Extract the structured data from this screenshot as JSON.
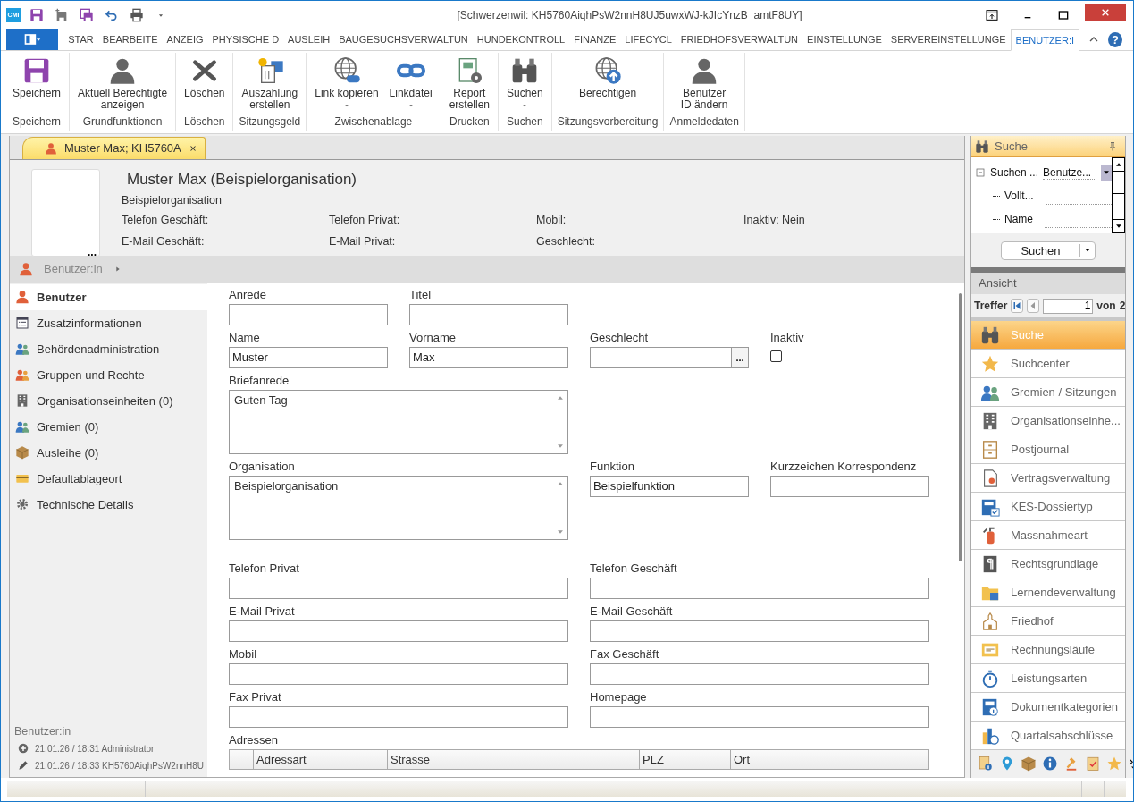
{
  "window": {
    "logo": "CMI",
    "title": "[Schwerzenwil: KH5760AiqhPsW2nnH8UJ5uwxWJ-kJIcYnzB_amtF8UY]",
    "help": "?"
  },
  "ribbon_tabs": [
    {
      "label": "STAR",
      "selected": false
    },
    {
      "label": "BEARBEITE",
      "selected": false
    },
    {
      "label": "ANZEIG",
      "selected": false
    },
    {
      "label": "PHYSISCHE D",
      "selected": false
    },
    {
      "label": "AUSLEIH",
      "selected": false
    },
    {
      "label": "BAUGESUCHSVERWALTUN",
      "selected": false
    },
    {
      "label": "HUNDEKONTROLL",
      "selected": false
    },
    {
      "label": "FINANZE",
      "selected": false
    },
    {
      "label": "LIFECYCL",
      "selected": false
    },
    {
      "label": "FRIEDHOFSVERWALTUN",
      "selected": false
    },
    {
      "label": "EINSTELLUNGE",
      "selected": false
    },
    {
      "label": "SERVEREINSTELLUNGE",
      "selected": false
    },
    {
      "label": "BENUTZER:I",
      "selected": true
    }
  ],
  "ribbon_groups": [
    {
      "label": "Speichern",
      "buttons": [
        {
          "label": "Speichern",
          "dropdown": false
        }
      ]
    },
    {
      "label": "Grundfunktionen",
      "buttons": [
        {
          "label": "Aktuell Berechtigte\nanzeigen",
          "dropdown": false
        }
      ]
    },
    {
      "label": "Löschen",
      "buttons": [
        {
          "label": "Löschen",
          "dropdown": false
        }
      ]
    },
    {
      "label": "Sitzungsgeld",
      "buttons": [
        {
          "label": "Auszahlung\nerstellen",
          "dropdown": false
        }
      ]
    },
    {
      "label": "Zwischenablage",
      "buttons": [
        {
          "label": "Link kopieren",
          "dropdown": true
        },
        {
          "label": "Linkdatei",
          "dropdown": true
        }
      ]
    },
    {
      "label": "Drucken",
      "buttons": [
        {
          "label": "Report\nerstellen",
          "dropdown": false
        }
      ]
    },
    {
      "label": "Suchen",
      "buttons": [
        {
          "label": "Suchen",
          "dropdown": true
        }
      ]
    },
    {
      "label": "Sitzungsvorbereitung",
      "buttons": [
        {
          "label": "Berechtigen",
          "dropdown": false
        }
      ]
    },
    {
      "label": "Anmeldedaten",
      "buttons": [
        {
          "label": "Benutzer\nID ändern",
          "dropdown": false
        }
      ]
    }
  ],
  "document_tab": {
    "label": "Muster Max; KH5760A",
    "selected": true
  },
  "header": {
    "title": "Muster Max (Beispielorganisation)",
    "subtitle": "Beispielorganisation",
    "photo_more": "...",
    "info": [
      "Telefon Geschäft:",
      "Telefon Privat:",
      "Mobil:",
      "Inaktiv: Nein",
      "E-Mail Geschäft:",
      "E-Mail Privat:",
      "Geschlecht:"
    ]
  },
  "breadcrumb": {
    "label": "Benutzer:in"
  },
  "nav": [
    {
      "label": "Benutzer",
      "selected": true
    },
    {
      "label": "Zusatzinformationen",
      "selected": false
    },
    {
      "label": "Behördenadministration",
      "selected": false
    },
    {
      "label": "Gruppen und Rechte",
      "selected": false
    },
    {
      "label": "Organisationseinheiten (0)",
      "selected": false
    },
    {
      "label": "Gremien (0)",
      "selected": false
    },
    {
      "label": "Ausleihe (0)",
      "selected": false
    },
    {
      "label": "Defaultablageort",
      "selected": false
    },
    {
      "label": "Technische Details",
      "selected": false
    }
  ],
  "audit": {
    "title": "Benutzer:in",
    "created": "21.01.26 / 18:31 Administrator",
    "modified": "21.01.26 / 18:33 KH5760AiqhPsW2nnH8U"
  },
  "form": {
    "sections": [
      {
        "rows": [
          [
            {
              "label": "Anrede",
              "kind": "text"
            },
            {
              "label": "Titel",
              "kind": "text"
            }
          ],
          [
            {
              "label": "Name",
              "kind": "text",
              "value": "Muster"
            },
            {
              "label": "Vorname",
              "kind": "text",
              "value": "Max"
            },
            {
              "label": "Geschlecht",
              "kind": "picker",
              "button": "..."
            },
            {
              "label": "Inaktiv",
              "kind": "checkbox",
              "checked": false
            }
          ],
          [
            {
              "label": "Briefanrede",
              "kind": "textarea",
              "value": "Guten Tag"
            }
          ],
          [
            {
              "label": "Organisation",
              "kind": "textarea",
              "value": "Beispielorganisation"
            },
            "",
            {
              "label": "Funktion",
              "kind": "text",
              "value": "Beispielfunktion"
            },
            {
              "label": "Kurzzeichen Korrespondenz",
              "kind": "text"
            }
          ]
        ]
      },
      {
        "rows": [
          [
            {
              "label": "Telefon Privat",
              "kind": "wide"
            },
            "",
            {
              "label": "Telefon Geschäft",
              "kind": "wide"
            }
          ],
          [
            {
              "label": "E-Mail Privat",
              "kind": "wide"
            },
            "",
            {
              "label": "E-Mail Geschäft",
              "kind": "wide"
            }
          ],
          [
            {
              "label": "Mobil",
              "kind": "wide"
            },
            "",
            {
              "label": "Fax Geschäft",
              "kind": "wide"
            }
          ],
          [
            {
              "label": "Fax Privat",
              "kind": "wide"
            },
            "",
            {
              "label": "Homepage",
              "kind": "wide"
            }
          ]
        ]
      }
    ]
  },
  "addresses": {
    "label": "Adressen",
    "columns": [
      "Adressart",
      "Strasse",
      "PLZ",
      "Ort"
    ]
  },
  "search_pane": {
    "title": "Suche",
    "tree": {
      "label": "Suchen ...",
      "value": "Benutze...",
      "expanded": true,
      "children": [
        {
          "label": "Vollt..."
        },
        {
          "label": "Name"
        }
      ]
    },
    "button": "Suchen",
    "view": "Ansicht",
    "hits_label": "Treffer",
    "page": "1",
    "of_label": "von",
    "pages": "2"
  },
  "module_nav": [
    {
      "label": "Suche",
      "selected": true
    },
    {
      "label": "Suchcenter",
      "selected": false
    },
    {
      "label": "Gremien / Sitzungen",
      "selected": false
    },
    {
      "label": "Organisationseinhe...",
      "selected": false
    },
    {
      "label": "Postjournal",
      "selected": false
    },
    {
      "label": "Vertragsverwaltung",
      "selected": false
    },
    {
      "label": "KES-Dossiertyp",
      "selected": false
    },
    {
      "label": "Massnahmeart",
      "selected": false
    },
    {
      "label": "Rechtsgrundlage",
      "selected": false
    },
    {
      "label": "Lernendeverwaltung",
      "selected": false
    },
    {
      "label": "Friedhof",
      "selected": false
    },
    {
      "label": "Rechnungsläufe",
      "selected": false
    },
    {
      "label": "Leistungsarten",
      "selected": false
    },
    {
      "label": "Dokumentkategorien",
      "selected": false
    },
    {
      "label": "Quartalsabschlüsse",
      "selected": false
    }
  ]
}
